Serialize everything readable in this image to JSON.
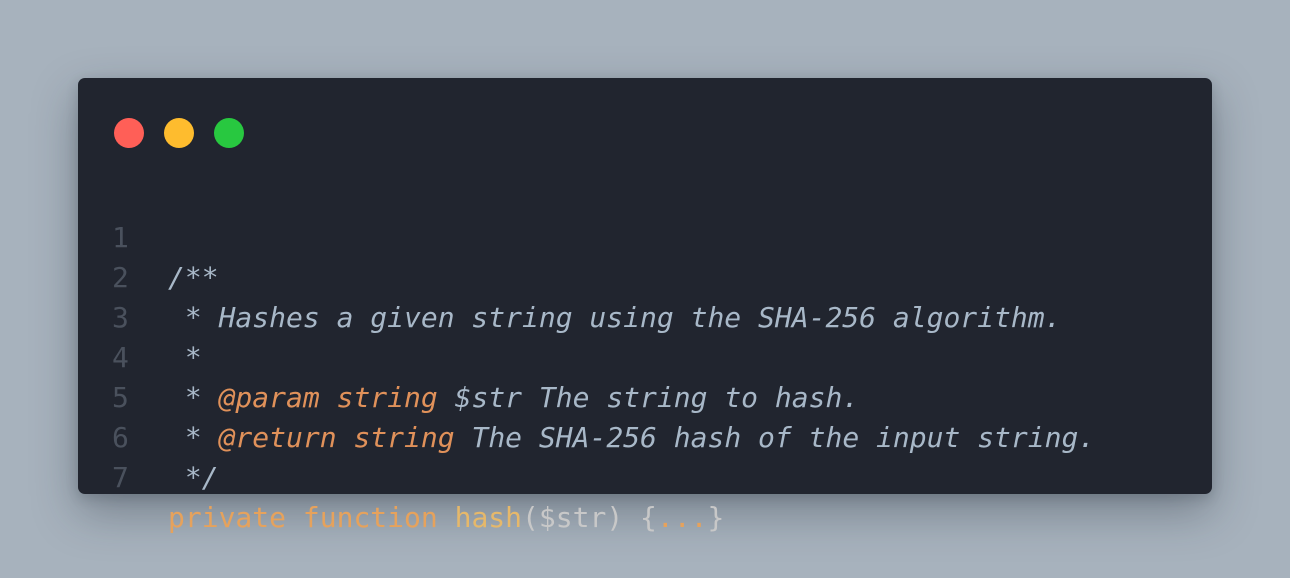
{
  "window": {
    "buttons": [
      {
        "name": "close",
        "color": "#ff5f57"
      },
      {
        "name": "minimize",
        "color": "#febc2e"
      },
      {
        "name": "maximize",
        "color": "#28c840"
      }
    ]
  },
  "code": {
    "line_numbers": [
      "1",
      "2",
      "3",
      "4",
      "5",
      "6",
      "7"
    ],
    "line1": "/**",
    "line2": " * Hashes a given string using the SHA-256 algorithm.",
    "line3": " *",
    "line4": {
      "prefix": " * ",
      "tag": "@param",
      "space1": " ",
      "type": "string",
      "rest": " $str The string to hash."
    },
    "line5": {
      "prefix": " * ",
      "tag": "@return",
      "space1": " ",
      "type": "string",
      "rest": " The SHA-256 hash of the input string."
    },
    "line6": " */",
    "line7": {
      "modifier": "private",
      "space1": " ",
      "keyword": "function",
      "space2": " ",
      "name": "hash",
      "params": "($str) ",
      "brace_open": "{",
      "fold": "...",
      "brace_close": "}"
    }
  },
  "colors": {
    "background": "#a7b2bd",
    "editor": "#21252f",
    "comment": "#a8b8c8",
    "doc_tag": "#e0915a",
    "keyword": "#e6a25c",
    "line_number": "#4a515d"
  }
}
